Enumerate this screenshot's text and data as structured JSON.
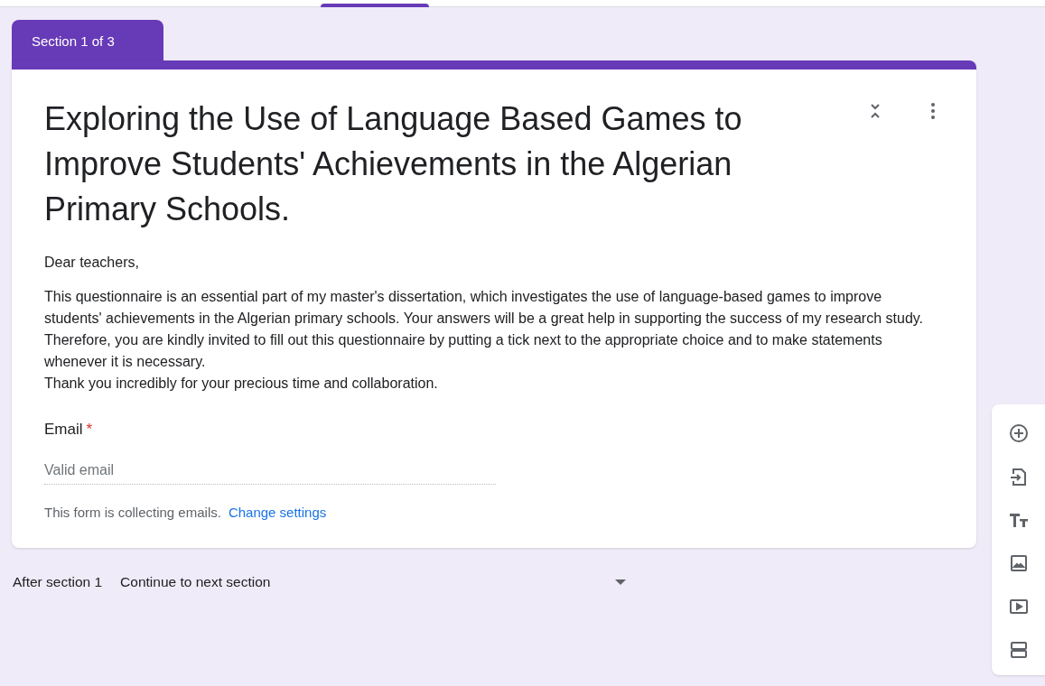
{
  "section_tab": {
    "label": "Section 1 of 3"
  },
  "form": {
    "title": "Exploring the Use of Language Based Games to Improve Students' Achievements in the Algerian Primary Schools.",
    "description": [
      "Dear teachers,",
      "This questionnaire is an essential part of my master's dissertation, which investigates the use of language-based games to improve students' achievements in the Algerian primary schools. Your answers will be a great help in supporting the success of my research study. Therefore, you are kindly invited to fill out this questionnaire by putting a tick next to the appropriate choice and to make statements whenever it is necessary.\nThank you incredibly for your precious time and collaboration."
    ]
  },
  "email_question": {
    "label": "Email",
    "required_mark": "*",
    "placeholder": "Valid email",
    "note": "This form is collecting emails.",
    "link": "Change settings"
  },
  "after_section": {
    "label": "After section 1",
    "value": "Continue to next section"
  }
}
